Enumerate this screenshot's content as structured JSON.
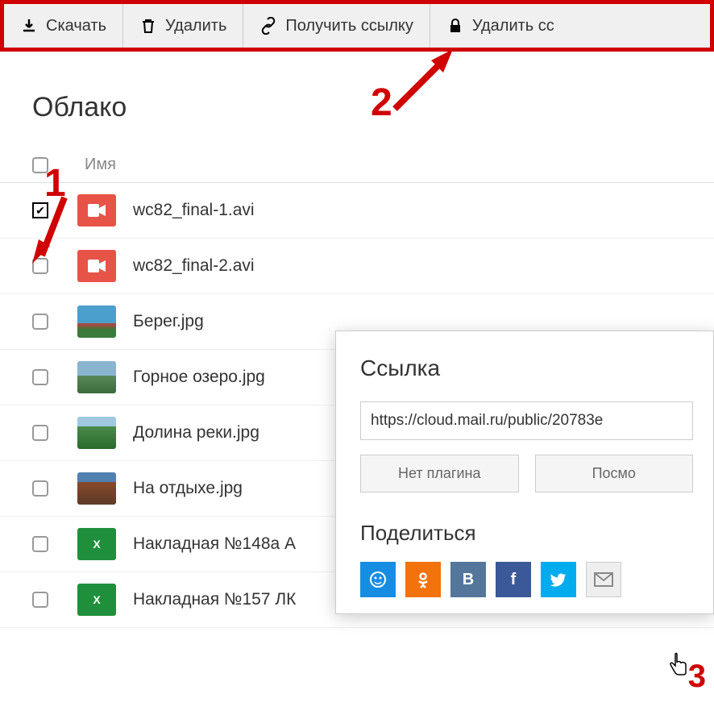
{
  "toolbar": {
    "download": "Скачать",
    "delete": "Удалить",
    "getlink": "Получить ссылку",
    "removelink": "Удалить сс"
  },
  "page": {
    "title": "Облако",
    "column_name": "Имя"
  },
  "files": [
    {
      "name": "wc82_final-1.avi",
      "type": "video",
      "checked": true
    },
    {
      "name": "wc82_final-2.avi",
      "type": "video",
      "checked": false
    },
    {
      "name": "Берег.jpg",
      "type": "photo1",
      "checked": false
    },
    {
      "name": "Горное озеро.jpg",
      "type": "photo2",
      "checked": false
    },
    {
      "name": "Долина реки.jpg",
      "type": "photo3",
      "checked": false
    },
    {
      "name": "На отдыхе.jpg",
      "type": "photo4",
      "checked": false
    },
    {
      "name": "Накладная №148а А",
      "type": "excel",
      "checked": false
    },
    {
      "name": "Накладная №157 ЛК",
      "type": "excel",
      "checked": false
    }
  ],
  "popup": {
    "title": "Ссылка",
    "url": "https://cloud.mail.ru/public/20783e",
    "no_plugin": "Нет плагина",
    "view": "Посмо",
    "share_title": "Поделиться"
  },
  "annotations": {
    "a1": "1",
    "a2": "2",
    "a3": "3"
  }
}
